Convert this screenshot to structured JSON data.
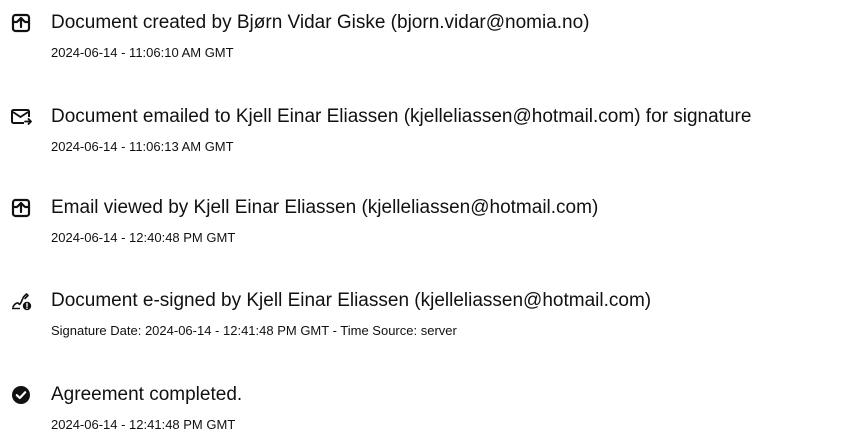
{
  "events": [
    {
      "icon": "document-upload-icon",
      "text": "Document created by Bjørn Vidar Giske (bjorn.vidar@nomia.no)",
      "detail": "2024-06-14 - 11:06:10 AM GMT"
    },
    {
      "icon": "email-send-icon",
      "text": "Document emailed to Kjell Einar Eliassen (kjelleliassen@hotmail.com) for signature",
      "detail": "2024-06-14 - 11:06:13 AM GMT"
    },
    {
      "icon": "document-upload-icon",
      "text": "Email viewed by Kjell Einar Eliassen (kjelleliassen@hotmail.com)",
      "detail": "2024-06-14 - 12:40:48 PM GMT"
    },
    {
      "icon": "signature-pen-icon",
      "text": "Document e-signed by Kjell Einar Eliassen (kjelleliassen@hotmail.com)",
      "detail": "Signature Date: 2024-06-14 - 12:41:48 PM GMT - Time Source: server"
    },
    {
      "icon": "check-circle-icon",
      "text": "Agreement completed.",
      "detail": "2024-06-14 - 12:41:48 PM GMT"
    }
  ]
}
